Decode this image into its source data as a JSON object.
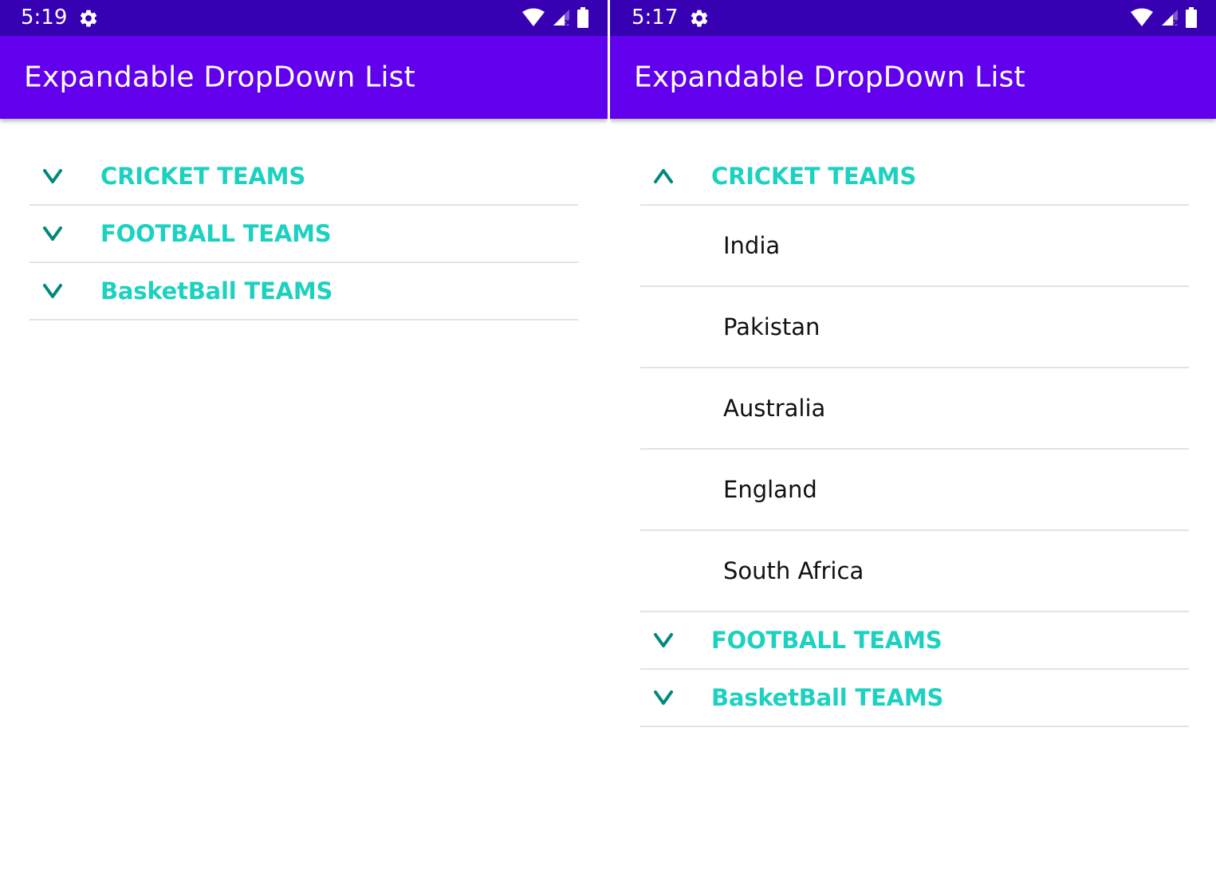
{
  "colors": {
    "status_bar": "#3700b3",
    "app_bar": "#6200ee",
    "group_text": "#1dd1c0",
    "chevron": "#00897b",
    "child_text": "#111111",
    "divider": "#e3e3e3"
  },
  "screens": [
    {
      "status": {
        "time": "5:19",
        "icons": [
          "gear-icon",
          "wifi-icon",
          "signal-icon",
          "battery-icon"
        ]
      },
      "app_title": "Expandable DropDown List",
      "groups": [
        {
          "label": "CRICKET TEAMS",
          "expanded": false,
          "icon": "chevron-down-icon",
          "children": []
        },
        {
          "label": "FOOTBALL TEAMS",
          "expanded": false,
          "icon": "chevron-down-icon",
          "children": []
        },
        {
          "label": "BasketBall TEAMS",
          "expanded": false,
          "icon": "chevron-down-icon",
          "children": []
        }
      ]
    },
    {
      "status": {
        "time": "5:17",
        "icons": [
          "gear-icon",
          "wifi-icon",
          "signal-icon",
          "battery-icon"
        ]
      },
      "app_title": "Expandable DropDown List",
      "groups": [
        {
          "label": "CRICKET TEAMS",
          "expanded": true,
          "icon": "chevron-up-icon",
          "children": [
            "India",
            "Pakistan",
            "Australia",
            "England",
            "South Africa"
          ]
        },
        {
          "label": "FOOTBALL TEAMS",
          "expanded": false,
          "icon": "chevron-down-icon",
          "children": []
        },
        {
          "label": "BasketBall TEAMS",
          "expanded": false,
          "icon": "chevron-down-icon",
          "children": []
        }
      ]
    }
  ]
}
